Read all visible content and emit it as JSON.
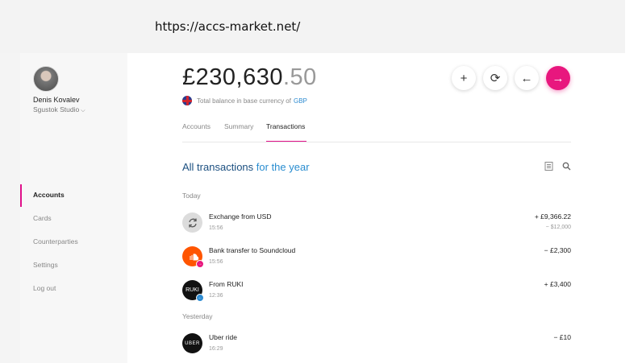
{
  "url": "https://accs-market.net/",
  "user": {
    "name": "Denis Kovalev",
    "company": "Sgustok Studio"
  },
  "nav": [
    {
      "label": "Accounts",
      "active": true
    },
    {
      "label": "Cards"
    },
    {
      "label": "Counterparties"
    },
    {
      "label": "Settings"
    },
    {
      "label": "Log out"
    }
  ],
  "balance": {
    "main": "£230,630",
    "cents": ".50",
    "caption": "Total balance in base currency of",
    "currency": "GBP"
  },
  "actions": {
    "add": "+",
    "exchange": "⟳",
    "back": "←",
    "send": "→"
  },
  "tabs": [
    "Accounts",
    "Summary",
    "Transactions"
  ],
  "section": {
    "part1": "All transactions",
    "part2": "for the year"
  },
  "days": [
    "Today",
    "Yesterday"
  ],
  "transactions": [
    {
      "title": "Exchange from USD",
      "time": "15:56",
      "amount": "+ £9,366.22",
      "sub": "− $12,000",
      "icon": "exchange-icon"
    },
    {
      "title": "Bank transfer to Soundcloud",
      "time": "15:56",
      "amount": "− £2,300",
      "icon": "soundcloud-icon"
    },
    {
      "title": "From RUKI",
      "time": "12:36",
      "amount": "+ £3,400",
      "icon": "ruki-logo",
      "icon_text": "RUKI"
    },
    {
      "title": "Uber ride",
      "time": "16:29",
      "amount": "− £10",
      "icon": "uber-logo",
      "icon_text": "UBER"
    }
  ],
  "colors": {
    "accent": "#e8177e",
    "link": "#2a8dd0",
    "soundcloud": "#ff5500"
  }
}
